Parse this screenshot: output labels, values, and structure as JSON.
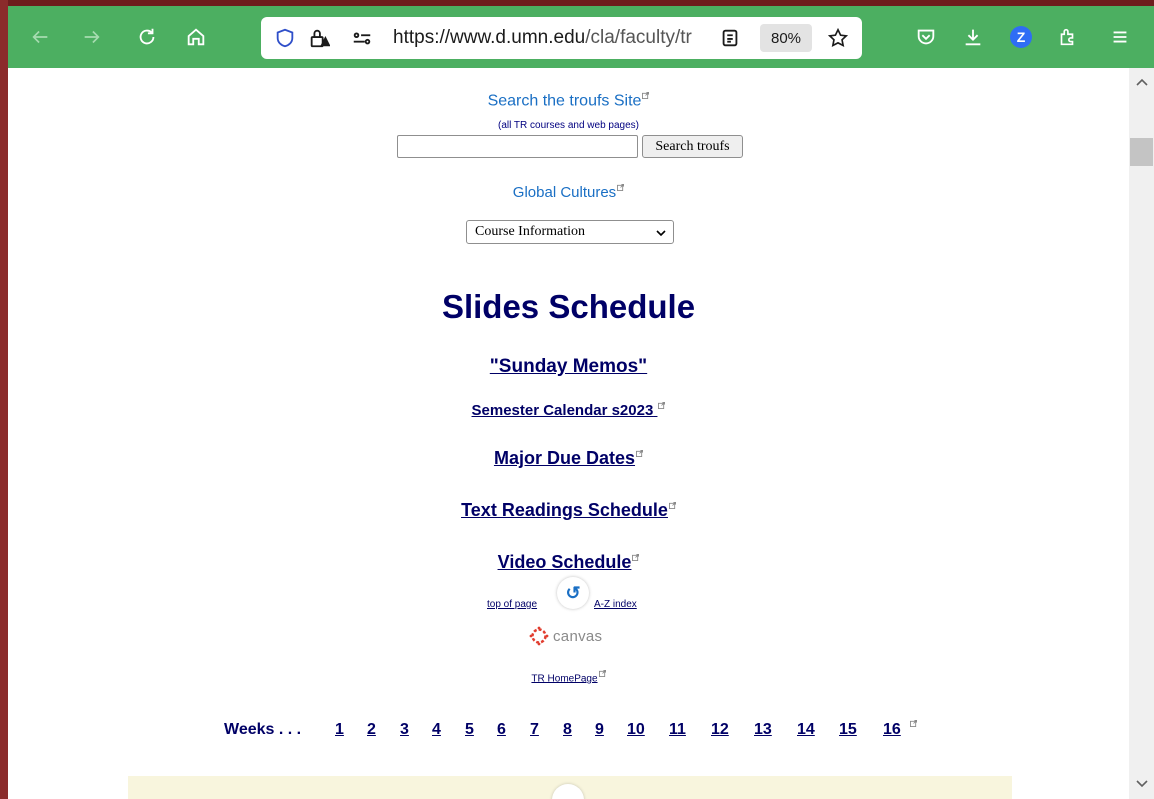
{
  "browser": {
    "url_highlight": "https://www.d.",
    "url_domain": "umn.edu",
    "url_path": "/cla/faculty/tr",
    "zoom": "80%",
    "profile_initial": "Z",
    "colors": {
      "toolbar": "#4caf61",
      "frame": "#8b2b2b"
    }
  },
  "search": {
    "title": "Search the troufs Site",
    "subtitle": "(all TR courses and web pages)",
    "input_value": "",
    "button_label": "Search troufs"
  },
  "global_cultures": "Global Cultures",
  "course_select": {
    "selected": "Course Information"
  },
  "page_title": "Slides Schedule",
  "links": {
    "memos": "\"Sunday Memos\"",
    "calendar": "Semester Calendar s2023",
    "due_dates": "Major Due Dates",
    "readings": "Text Readings Schedule",
    "video": "Video Schedule"
  },
  "nav": {
    "top_of_page": "top of page",
    "az_index": "A-Z index",
    "canvas": "canvas",
    "homepage": "TR HomePage"
  },
  "weeks": {
    "label": "Weeks . . .",
    "items": [
      "1",
      "2",
      "3",
      "4",
      "5",
      "6",
      "7",
      "8",
      "9",
      "10",
      "11",
      "12",
      "13",
      "14",
      "15",
      "16"
    ]
  }
}
